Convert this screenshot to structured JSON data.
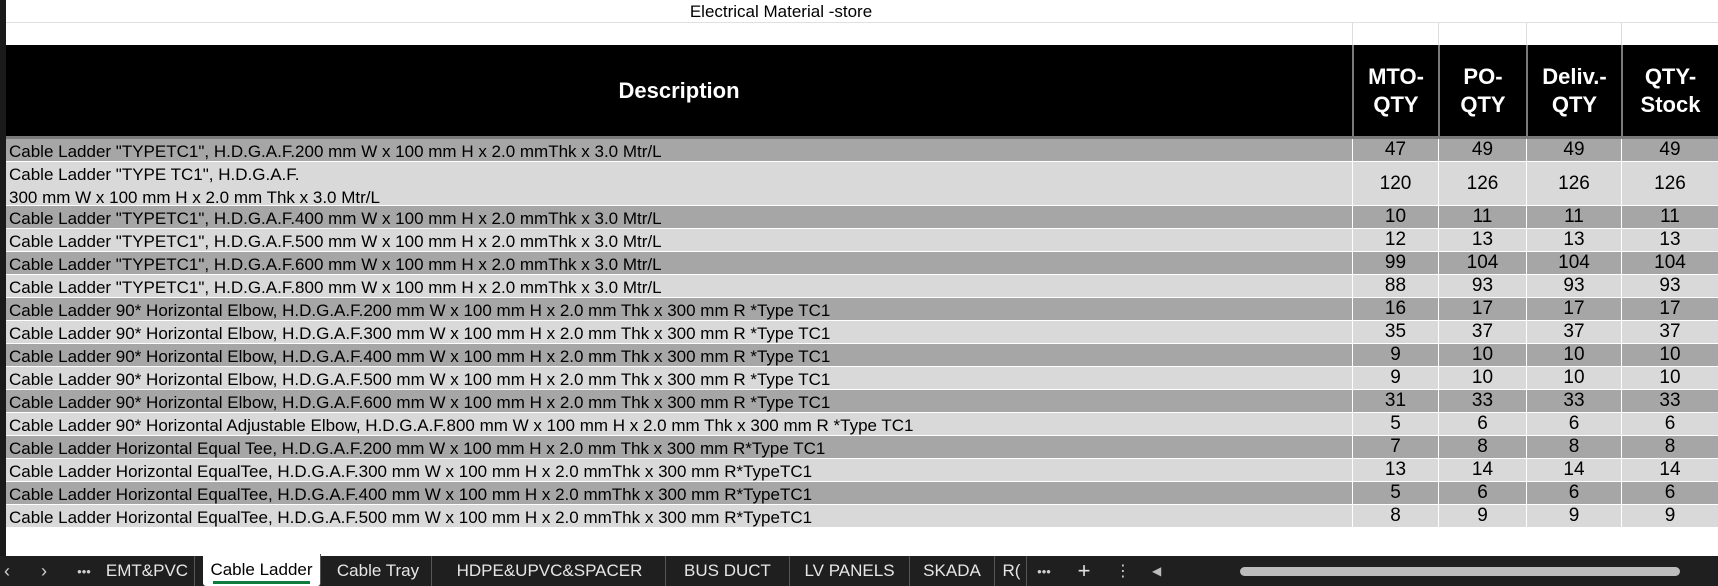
{
  "sheet_title": "Electrical Material -store",
  "headers": {
    "description": "Description",
    "mto_qty": "MTO-\nQTY",
    "po_qty": "PO-\nQTY",
    "deliv_qty": "Deliv.-\nQTY",
    "qty_stock": "QTY-\nStock"
  },
  "rows": [
    {
      "desc": "Cable Ladder \"TYPETC1\", H.D.G.A.F.200 mm W x 100 mm H x 2.0 mmThk x 3.0 Mtr/L",
      "mto": "47",
      "po": "49",
      "deliv": "49",
      "stock": "49"
    },
    {
      "desc": "Cable Ladder \"TYPE TC1\", H.D.G.A.F.\n300 mm W x 100 mm H x 2.0 mm Thk x 3.0 Mtr/L",
      "mto": "120",
      "po": "126",
      "deliv": "126",
      "stock": "126"
    },
    {
      "desc": "Cable Ladder \"TYPETC1\", H.D.G.A.F.400 mm W x 100 mm H x 2.0 mmThk x 3.0 Mtr/L",
      "mto": "10",
      "po": "11",
      "deliv": "11",
      "stock": "11"
    },
    {
      "desc": "Cable Ladder \"TYPETC1\", H.D.G.A.F.500 mm W x 100 mm H x 2.0 mmThk x 3.0 Mtr/L",
      "mto": "12",
      "po": "13",
      "deliv": "13",
      "stock": "13"
    },
    {
      "desc": "Cable Ladder \"TYPETC1\", H.D.G.A.F.600 mm W x 100 mm H x 2.0 mmThk x 3.0 Mtr/L",
      "mto": "99",
      "po": "104",
      "deliv": "104",
      "stock": "104"
    },
    {
      "desc": "Cable Ladder \"TYPETC1\", H.D.G.A.F.800 mm W x 100 mm H x 2.0 mmThk x 3.0 Mtr/L",
      "mto": "88",
      "po": "93",
      "deliv": "93",
      "stock": "93"
    },
    {
      "desc": "Cable Ladder 90* Horizontal Elbow, H.D.G.A.F.200 mm W x 100 mm H x 2.0 mm Thk x 300 mm R *Type TC1",
      "mto": "16",
      "po": "17",
      "deliv": "17",
      "stock": "17"
    },
    {
      "desc": "Cable Ladder 90* Horizontal Elbow, H.D.G.A.F.300 mm W x 100 mm H x 2.0 mm Thk x 300 mm R *Type TC1",
      "mto": "35",
      "po": "37",
      "deliv": "37",
      "stock": "37"
    },
    {
      "desc": "Cable Ladder 90* Horizontal Elbow, H.D.G.A.F.400 mm W x 100 mm H x 2.0 mm Thk x 300 mm R *Type TC1",
      "mto": "9",
      "po": "10",
      "deliv": "10",
      "stock": "10"
    },
    {
      "desc": "Cable Ladder 90* Horizontal Elbow, H.D.G.A.F.500 mm W x 100 mm H x 2.0 mm Thk x 300 mm R *Type TC1",
      "mto": "9",
      "po": "10",
      "deliv": "10",
      "stock": "10"
    },
    {
      "desc": "Cable Ladder 90* Horizontal Elbow, H.D.G.A.F.600 mm W x 100 mm H x 2.0 mm Thk x 300 mm R *Type TC1",
      "mto": "31",
      "po": "33",
      "deliv": "33",
      "stock": "33"
    },
    {
      "desc": "Cable Ladder 90* Horizontal Adjustable Elbow, H.D.G.A.F.800 mm W x 100 mm H x 2.0 mm Thk x 300 mm R *Type TC1",
      "mto": "5",
      "po": "6",
      "deliv": "6",
      "stock": "6"
    },
    {
      "desc": "Cable Ladder Horizontal Equal Tee, H.D.G.A.F.200 mm W x 100 mm H x 2.0 mm Thk x 300 mm R*Type TC1",
      "mto": "7",
      "po": "8",
      "deliv": "8",
      "stock": "8"
    },
    {
      "desc": "Cable Ladder Horizontal EqualTee, H.D.G.A.F.300 mm W x 100 mm H x 2.0 mmThk x 300 mm R*TypeTC1",
      "mto": "13",
      "po": "14",
      "deliv": "14",
      "stock": "14"
    },
    {
      "desc": "Cable Ladder Horizontal EqualTee, H.D.G.A.F.400 mm W x 100 mm H x 2.0 mmThk x 300 mm R*TypeTC1",
      "mto": "5",
      "po": "6",
      "deliv": "6",
      "stock": "6"
    },
    {
      "desc": "Cable Ladder Horizontal EqualTee, H.D.G.A.F.500 mm W x 100 mm H x 2.0 mmThk x 300 mm R*TypeTC1",
      "mto": "8",
      "po": "9",
      "deliv": "9",
      "stock": "9"
    }
  ],
  "tabs": {
    "prev_icon": "chevron-left-icon",
    "next_icon": "chevron-right-icon",
    "more_left_label": "•••",
    "items": [
      "EMT&PVC",
      "Cable Ladder",
      "Cable Tray",
      "HDPE&UPVC&SPACER",
      "BUS DUCT",
      "LV PANELS",
      "SKADA",
      "R("
    ],
    "active_index": 1,
    "more_right_label": "•••",
    "add_label": "+",
    "options_label": "⋮"
  },
  "colors": {
    "header_bg": "#000000",
    "row_dark": "#a6a6a6",
    "row_light": "#d9d9d9",
    "active_tab_accent": "#0f7b3f"
  }
}
